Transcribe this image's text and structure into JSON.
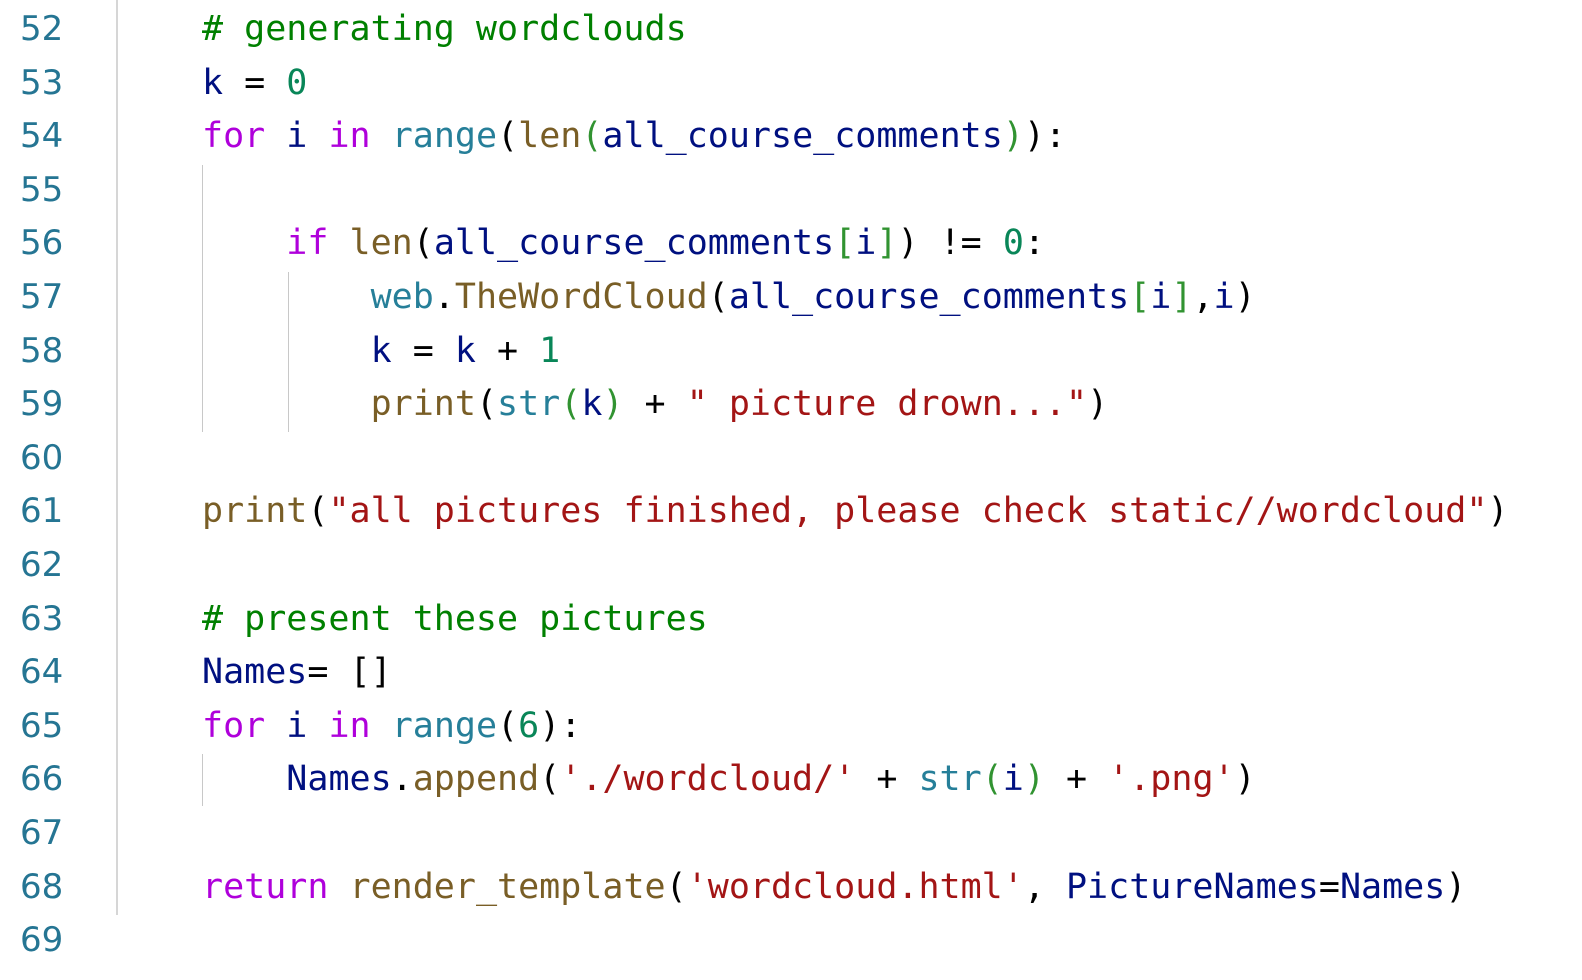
{
  "editor": {
    "line_numbers": [
      "52",
      "53",
      "54",
      "55",
      "56",
      "57",
      "58",
      "59",
      "60",
      "61",
      "62",
      "63",
      "64",
      "65",
      "66",
      "67",
      "68",
      "69"
    ],
    "lines": [
      [
        {
          "t": "# generating wordclouds",
          "c": "cm"
        }
      ],
      [
        {
          "t": "k",
          "c": "vr"
        },
        {
          "t": " = ",
          "c": "op"
        },
        {
          "t": "0",
          "c": "nm"
        }
      ],
      [
        {
          "t": "for",
          "c": "kw"
        },
        {
          "t": " ",
          "c": "op"
        },
        {
          "t": "i",
          "c": "vr"
        },
        {
          "t": " ",
          "c": "op"
        },
        {
          "t": "in",
          "c": "kw"
        },
        {
          "t": " ",
          "c": "op"
        },
        {
          "t": "range",
          "c": "bi"
        },
        {
          "t": "(",
          "c": "pn"
        },
        {
          "t": "len",
          "c": "fn"
        },
        {
          "t": "(",
          "c": "b2"
        },
        {
          "t": "all_course_comments",
          "c": "vr"
        },
        {
          "t": ")",
          "c": "b2"
        },
        {
          "t": "):",
          "c": "pn"
        }
      ],
      [],
      [
        {
          "t": "    ",
          "c": "op"
        },
        {
          "t": "if",
          "c": "kw"
        },
        {
          "t": " ",
          "c": "op"
        },
        {
          "t": "len",
          "c": "fn"
        },
        {
          "t": "(",
          "c": "pn"
        },
        {
          "t": "all_course_comments",
          "c": "vr"
        },
        {
          "t": "[",
          "c": "b2"
        },
        {
          "t": "i",
          "c": "vr"
        },
        {
          "t": "]",
          "c": "b2"
        },
        {
          "t": ")",
          "c": "pn"
        },
        {
          "t": " != ",
          "c": "op"
        },
        {
          "t": "0",
          "c": "nm"
        },
        {
          "t": ":",
          "c": "pn"
        }
      ],
      [
        {
          "t": "        ",
          "c": "op"
        },
        {
          "t": "web",
          "c": "bi"
        },
        {
          "t": ".",
          "c": "pn"
        },
        {
          "t": "TheWordCloud",
          "c": "fn"
        },
        {
          "t": "(",
          "c": "pn"
        },
        {
          "t": "all_course_comments",
          "c": "vr"
        },
        {
          "t": "[",
          "c": "b2"
        },
        {
          "t": "i",
          "c": "vr"
        },
        {
          "t": "]",
          "c": "b2"
        },
        {
          "t": ",",
          "c": "pn"
        },
        {
          "t": "i",
          "c": "vr"
        },
        {
          "t": ")",
          "c": "pn"
        }
      ],
      [
        {
          "t": "        ",
          "c": "op"
        },
        {
          "t": "k",
          "c": "vr"
        },
        {
          "t": " = ",
          "c": "op"
        },
        {
          "t": "k",
          "c": "vr"
        },
        {
          "t": " + ",
          "c": "op"
        },
        {
          "t": "1",
          "c": "nm"
        }
      ],
      [
        {
          "t": "        ",
          "c": "op"
        },
        {
          "t": "print",
          "c": "fn"
        },
        {
          "t": "(",
          "c": "pn"
        },
        {
          "t": "str",
          "c": "bi"
        },
        {
          "t": "(",
          "c": "b2"
        },
        {
          "t": "k",
          "c": "vr"
        },
        {
          "t": ")",
          "c": "b2"
        },
        {
          "t": " + ",
          "c": "op"
        },
        {
          "t": "\" picture drown...\"",
          "c": "st"
        },
        {
          "t": ")",
          "c": "pn"
        }
      ],
      [],
      [
        {
          "t": "print",
          "c": "fn"
        },
        {
          "t": "(",
          "c": "pn"
        },
        {
          "t": "\"all pictures finished, please check static//wordcloud\"",
          "c": "st"
        },
        {
          "t": ")",
          "c": "pn"
        }
      ],
      [],
      [
        {
          "t": "# present these pictures",
          "c": "cm"
        }
      ],
      [
        {
          "t": "Names",
          "c": "vr"
        },
        {
          "t": "= ",
          "c": "op"
        },
        {
          "t": "[]",
          "c": "pn"
        }
      ],
      [
        {
          "t": "for",
          "c": "kw"
        },
        {
          "t": " ",
          "c": "op"
        },
        {
          "t": "i",
          "c": "vr"
        },
        {
          "t": " ",
          "c": "op"
        },
        {
          "t": "in",
          "c": "kw"
        },
        {
          "t": " ",
          "c": "op"
        },
        {
          "t": "range",
          "c": "bi"
        },
        {
          "t": "(",
          "c": "pn"
        },
        {
          "t": "6",
          "c": "nm"
        },
        {
          "t": "):",
          "c": "pn"
        }
      ],
      [
        {
          "t": "    ",
          "c": "op"
        },
        {
          "t": "Names",
          "c": "vr"
        },
        {
          "t": ".",
          "c": "pn"
        },
        {
          "t": "append",
          "c": "fn"
        },
        {
          "t": "(",
          "c": "pn"
        },
        {
          "t": "'./wordcloud/'",
          "c": "st"
        },
        {
          "t": " + ",
          "c": "op"
        },
        {
          "t": "str",
          "c": "bi"
        },
        {
          "t": "(",
          "c": "b2"
        },
        {
          "t": "i",
          "c": "vr"
        },
        {
          "t": ")",
          "c": "b2"
        },
        {
          "t": " + ",
          "c": "op"
        },
        {
          "t": "'.png'",
          "c": "st"
        },
        {
          "t": ")",
          "c": "pn"
        }
      ],
      [],
      [
        {
          "t": "return",
          "c": "kw"
        },
        {
          "t": " ",
          "c": "op"
        },
        {
          "t": "render_template",
          "c": "fn"
        },
        {
          "t": "(",
          "c": "pn"
        },
        {
          "t": "'wordcloud.html'",
          "c": "st"
        },
        {
          "t": ", ",
          "c": "pn"
        },
        {
          "t": "PictureNames",
          "c": "vr"
        },
        {
          "t": "=",
          "c": "op"
        },
        {
          "t": "Names",
          "c": "vr"
        },
        {
          "t": ")",
          "c": "pn"
        }
      ],
      []
    ]
  },
  "colors": {
    "line_number": "#257593",
    "keyword": "#af00db",
    "function": "#795e26",
    "builtin": "#267f99",
    "variable": "#001080",
    "number": "#098658",
    "string": "#a31515",
    "comment": "#008000"
  }
}
